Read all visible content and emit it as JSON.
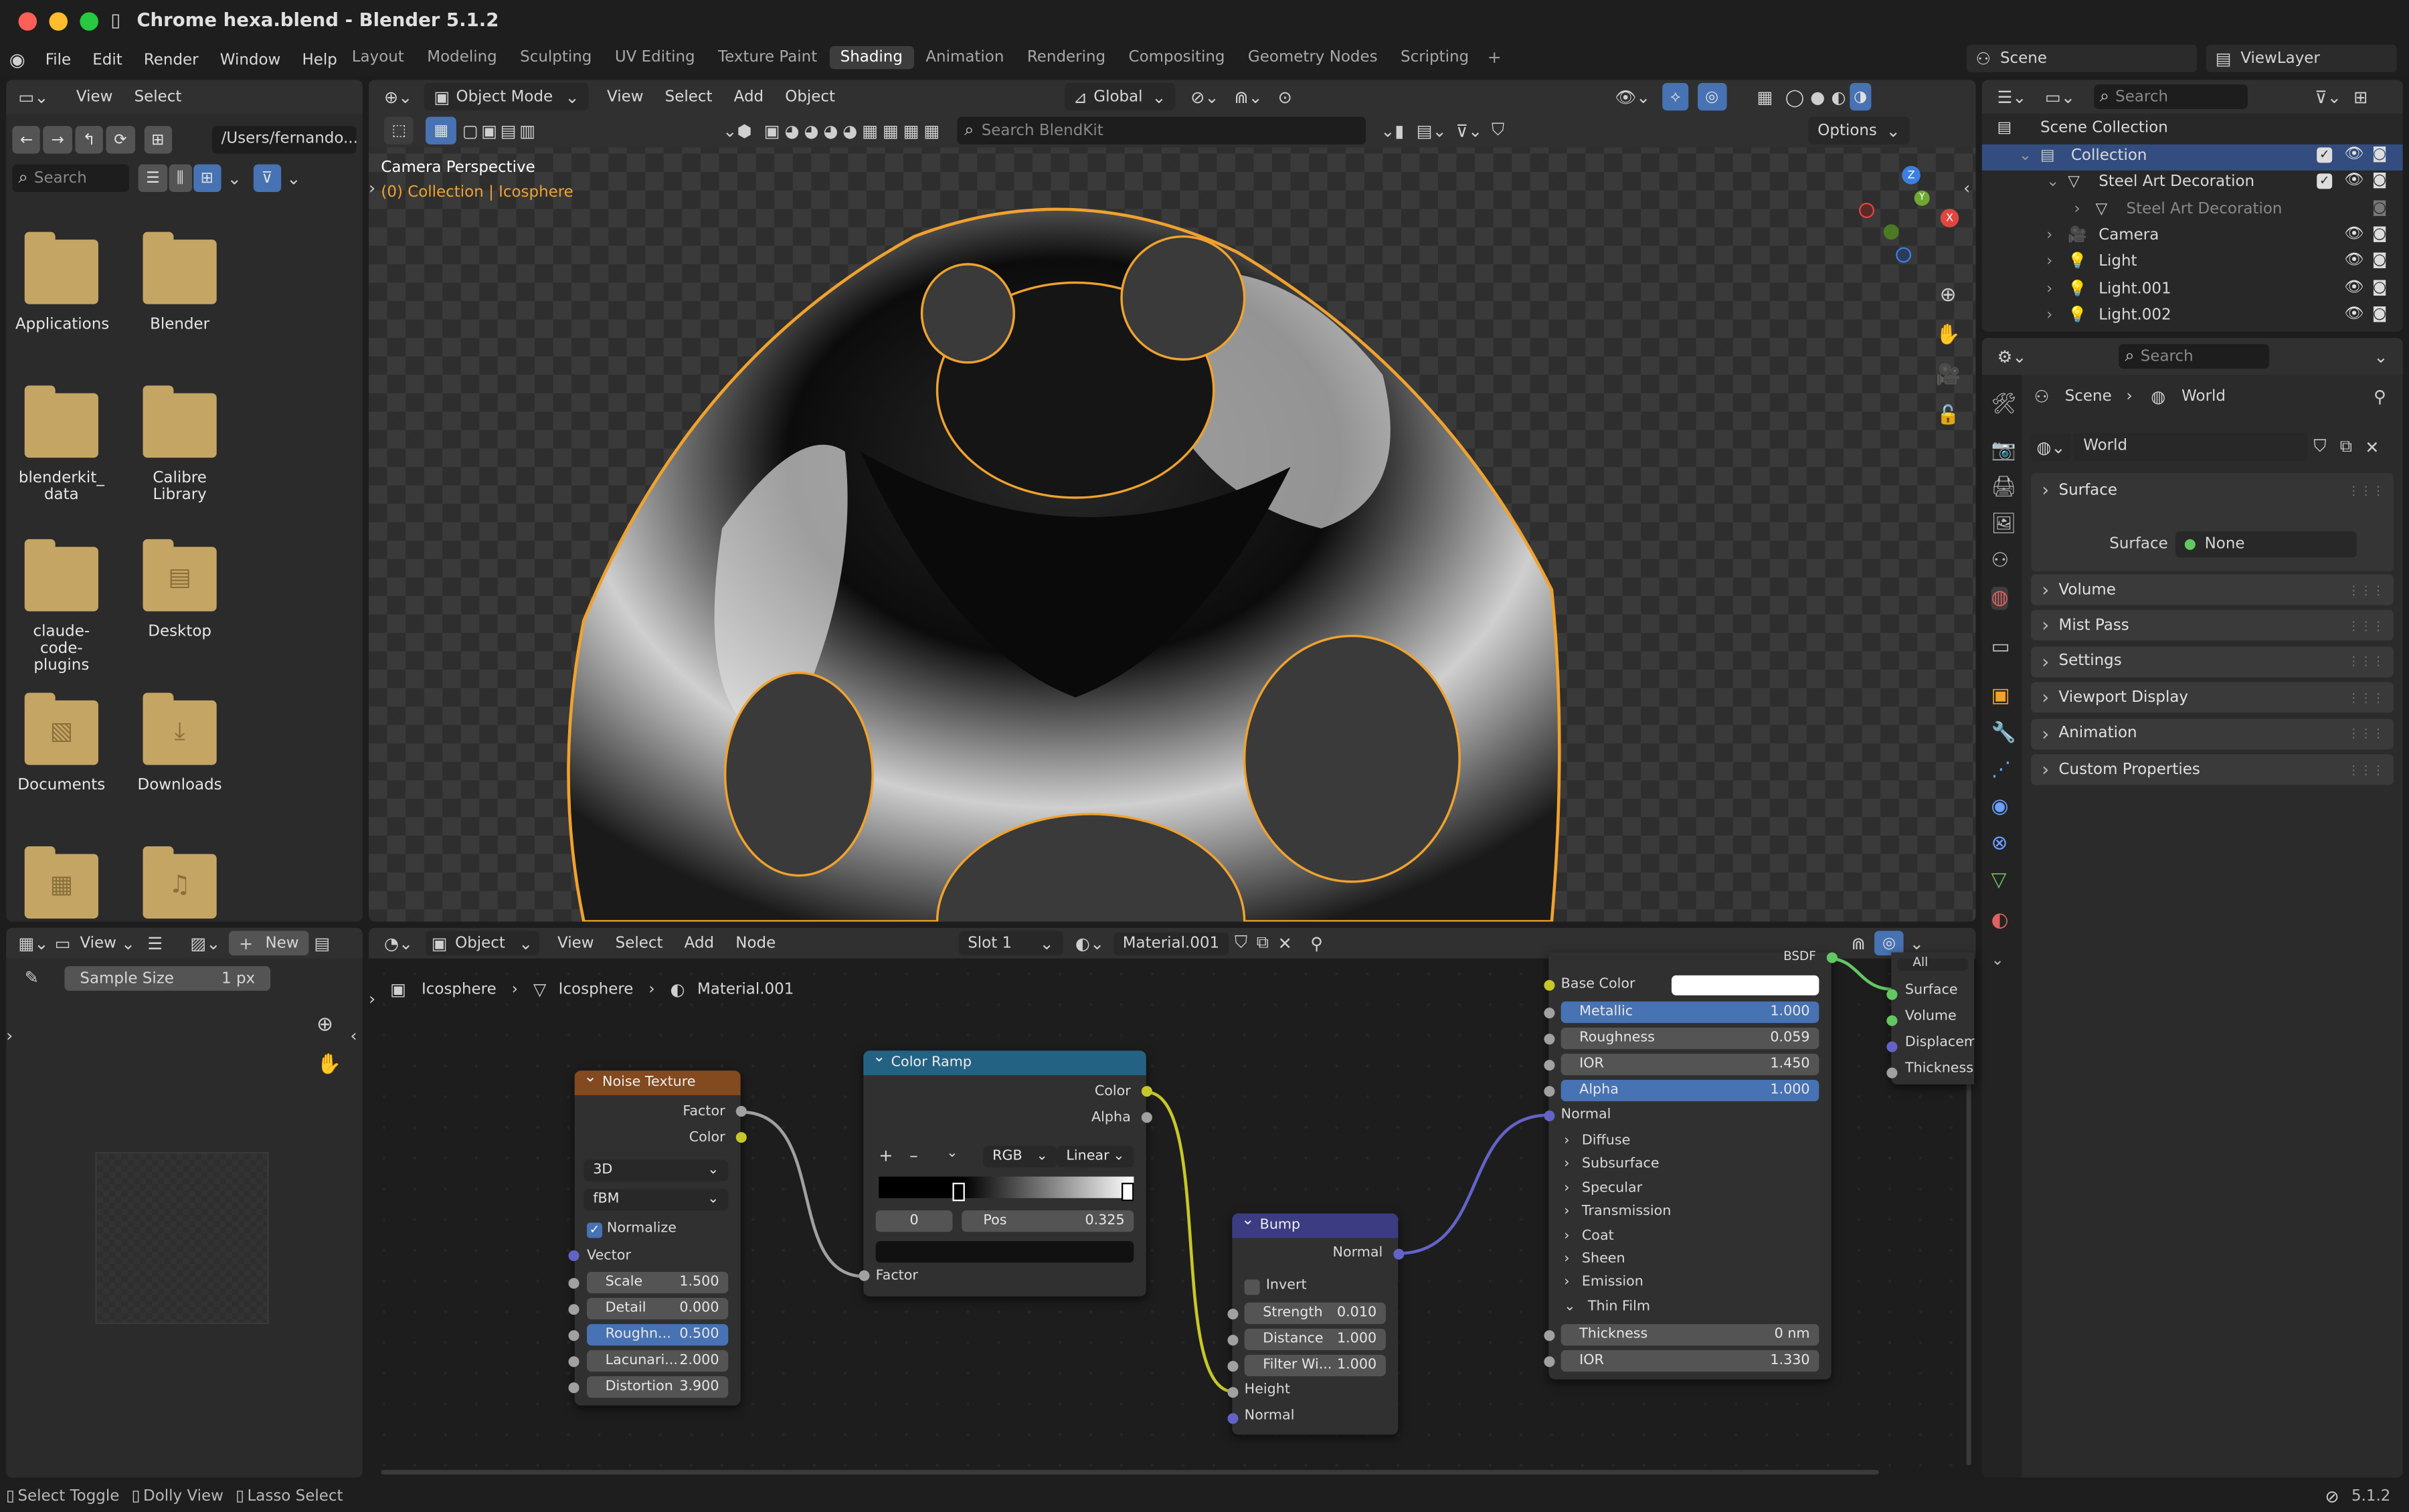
{
  "window": {
    "title": "Chrome hexa.blend - Blender 5.1.2"
  },
  "menubar": {
    "items": [
      "File",
      "Edit",
      "Render",
      "Window",
      "Help"
    ]
  },
  "workspaces": [
    "Layout",
    "Modeling",
    "Sculpting",
    "UV Editing",
    "Texture Paint",
    "Shading",
    "Animation",
    "Rendering",
    "Compositing",
    "Geometry Nodes",
    "Scripting"
  ],
  "active_workspace": "Shading",
  "scene": "Scene",
  "viewlayer": "ViewLayer",
  "filebrowser": {
    "menus": [
      "View",
      "Select"
    ],
    "path": "/Users/fernando...",
    "search": "Search",
    "items": [
      {
        "name": "Applications",
        "kind": "folder"
      },
      {
        "name": "Blender",
        "kind": "folder"
      },
      {
        "name": "blenderkit_\ndata",
        "kind": "folder"
      },
      {
        "name": "Calibre Library",
        "kind": "folder"
      },
      {
        "name": "claude-code-\nplugins",
        "kind": "folder"
      },
      {
        "name": "Desktop",
        "kind": "desktop"
      },
      {
        "name": "Documents",
        "kind": "docs"
      },
      {
        "name": "Downloads",
        "kind": "downloads"
      },
      {
        "name": "",
        "kind": "movies"
      },
      {
        "name": "",
        "kind": "music"
      }
    ]
  },
  "viewport": {
    "mode": "Object Mode",
    "menus": [
      "View",
      "Select",
      "Add",
      "Object"
    ],
    "orientation": "Global",
    "search": "Search BlendKit",
    "options": "Options",
    "label": "Camera Perspective",
    "context": "(0) Collection | Icosphere"
  },
  "outliner": {
    "search": "Search",
    "root": "Scene Collection",
    "rows": [
      {
        "name": "Collection",
        "indent": 0
      },
      {
        "name": "Steel Art Decoration",
        "indent": 1
      },
      {
        "name": "Steel Art Decoration",
        "indent": 2,
        "dim": true
      },
      {
        "name": "Camera",
        "indent": 1
      },
      {
        "name": "Light",
        "indent": 1
      },
      {
        "name": "Light.001",
        "indent": 1
      },
      {
        "name": "Light.002",
        "indent": 1
      }
    ]
  },
  "properties": {
    "search": "Search",
    "crumb1": "Scene",
    "crumb2": "World",
    "world": "World",
    "surface_section": "Surface",
    "surface_label": "Surface",
    "surface_value": "None",
    "sections": [
      "Volume",
      "Mist Pass",
      "Settings",
      "Viewport Display",
      "Animation",
      "Custom Properties"
    ]
  },
  "image_editor": {
    "menus": [
      "View"
    ],
    "new": "New",
    "sample_label": "Sample Size",
    "sample_value": "1 px"
  },
  "node_editor": {
    "type": "Object",
    "menus": [
      "View",
      "Select",
      "Add",
      "Node"
    ],
    "slot": "Slot 1",
    "material": "Material.001",
    "crumbs": [
      "Icosphere",
      "Icosphere",
      "Material.001"
    ],
    "noise": {
      "title": "Noise Texture",
      "out1": "Factor",
      "out2": "Color",
      "dim": "3D",
      "type": "fBM",
      "normalize": "Normalize",
      "vector": "Vector",
      "fields": [
        {
          "l": "Scale",
          "v": "1.500"
        },
        {
          "l": "Detail",
          "v": "0.000"
        },
        {
          "l": "Roughn...",
          "v": "0.500"
        },
        {
          "l": "Lacunari...",
          "v": "2.000"
        },
        {
          "l": "Distortion",
          "v": "3.900"
        }
      ]
    },
    "ramp": {
      "title": "Color Ramp",
      "out1": "Color",
      "out2": "Alpha",
      "mode": "RGB",
      "interp": "Linear",
      "idx": "0",
      "pos_l": "Pos",
      "pos_v": "0.325",
      "in": "Factor"
    },
    "bump": {
      "title": "Bump",
      "out": "Normal",
      "invert": "Invert",
      "fields": [
        {
          "l": "Strength",
          "v": "0.010"
        },
        {
          "l": "Distance",
          "v": "1.000"
        },
        {
          "l": "Filter Wi...",
          "v": "1.000"
        }
      ],
      "in1": "Height",
      "in2": "Normal"
    },
    "bsdf": {
      "title": "BSDF",
      "base": "Base Color",
      "fields": [
        {
          "l": "Metallic",
          "v": "1.000"
        },
        {
          "l": "Roughness",
          "v": "0.059"
        },
        {
          "l": "IOR",
          "v": "1.450"
        },
        {
          "l": "Alpha",
          "v": "1.000"
        }
      ],
      "normal": "Normal",
      "subs": [
        "Diffuse",
        "Subsurface",
        "Specular",
        "Transmission",
        "Coat",
        "Sheen",
        "Emission",
        "Thin Film"
      ],
      "f2": [
        {
          "l": "Thickness",
          "v": "0 nm"
        },
        {
          "l": "IOR",
          "v": "1.330"
        }
      ]
    },
    "output": {
      "title": "All",
      "sockets": [
        "Surface",
        "Volume",
        "Displaceme",
        "Thickness"
      ]
    }
  },
  "statusbar": {
    "items": [
      "Select Toggle",
      "Dolly View",
      "Lasso Select"
    ],
    "version": "5.1.2"
  }
}
